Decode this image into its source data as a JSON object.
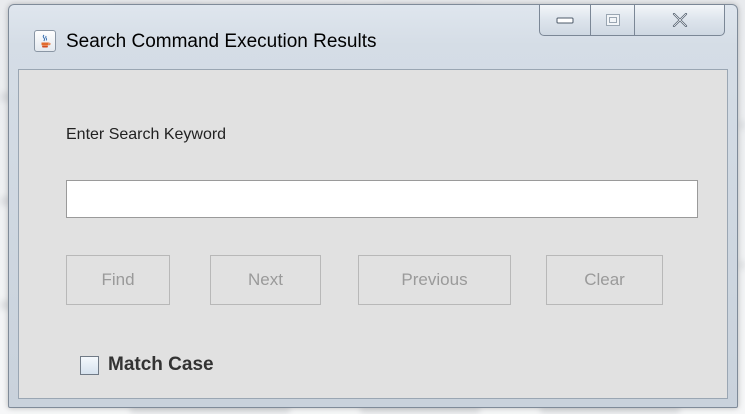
{
  "window": {
    "title": "Search Command Execution Results",
    "app_icon": "java-cup-icon",
    "controls": {
      "minimize_icon": "minimize-icon",
      "maximize_icon": "maximize-icon",
      "close_icon": "close-icon"
    }
  },
  "search": {
    "label": "Enter Search Keyword",
    "value": "",
    "placeholder": ""
  },
  "buttons": {
    "find": "Find",
    "next": "Next",
    "previous": "Previous",
    "clear": "Clear"
  },
  "match_case": {
    "label": "Match Case",
    "checked": false
  },
  "colors": {
    "client_background": "#e1e1e1",
    "disabled_text": "#9a9a9a",
    "window_frame": "#d5dde6"
  }
}
